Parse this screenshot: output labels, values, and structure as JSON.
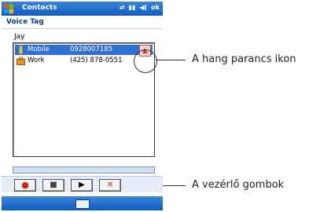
{
  "titlebar": {
    "app_title": "Contacts",
    "ok_label": "ok"
  },
  "header": {
    "page_title": "Voice Tag"
  },
  "contact": {
    "name": "Jay"
  },
  "phone_list": [
    {
      "label": "Mobile",
      "number": "0928007185",
      "icon": "mobile-phone-icon",
      "selected": true
    },
    {
      "label": "Work",
      "number": "(425) 878-0551",
      "icon": "work-phone-icon",
      "selected": false
    }
  ],
  "controls": [
    {
      "name": "record",
      "glyph": "●"
    },
    {
      "name": "stop",
      "glyph": "■"
    },
    {
      "name": "play",
      "glyph": "▶"
    },
    {
      "name": "delete",
      "glyph": "✕"
    }
  ],
  "annotations": {
    "voice_command_icon": "A hang parancs ikon",
    "control_buttons": "A vezérlő gombok"
  },
  "colors": {
    "title_bar": "#1a66c8",
    "selection": "#2f6fd6",
    "record": "#d81f1f"
  }
}
